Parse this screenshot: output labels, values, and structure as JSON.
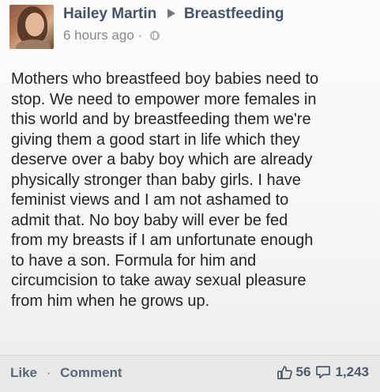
{
  "post": {
    "author": "Hailey Martin",
    "group": "Breastfeeding",
    "timestamp": "6 hours ago ·",
    "body": "Mothers who breastfeed boy babies need to\nstop. We need to empower more females in\nthis world and by breastfeeding them we're\ngiving them a good start in life which they\ndeserve over a baby boy which are already\nphysically stronger than baby girls. I have\nfeminist views and I am not ashamed to\nadmit that. No boy baby will ever be fed\nfrom my breasts if I am unfortunate enough\nto have a son. Formula for him and\ncircumcision to take away sexual pleasure\nfrom him when he grows up."
  },
  "footer": {
    "like_label": "Like",
    "separator": "·",
    "comment_label": "Comment",
    "likes_count": "56",
    "comments_count": "1,243"
  },
  "icons": {
    "avatar": "profile-photo",
    "arrow": "right-triangle-icon",
    "globe": "globe-icon",
    "like": "thumbs-up-icon",
    "comment": "speech-bubble-icon"
  }
}
